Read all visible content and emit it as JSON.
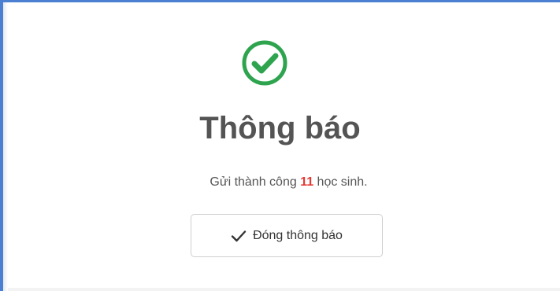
{
  "dialog": {
    "title": "Thông báo",
    "message_prefix": "Gửi thành công ",
    "count": "11",
    "message_suffix": " học sinh.",
    "close_button_label": "Đóng thông báo",
    "icon": "check-circle-icon",
    "button_icon": "checkmark-icon"
  },
  "colors": {
    "success_green": "#2ea44f",
    "count_red": "#e53935",
    "frame_blue": "#4a7fd1"
  }
}
